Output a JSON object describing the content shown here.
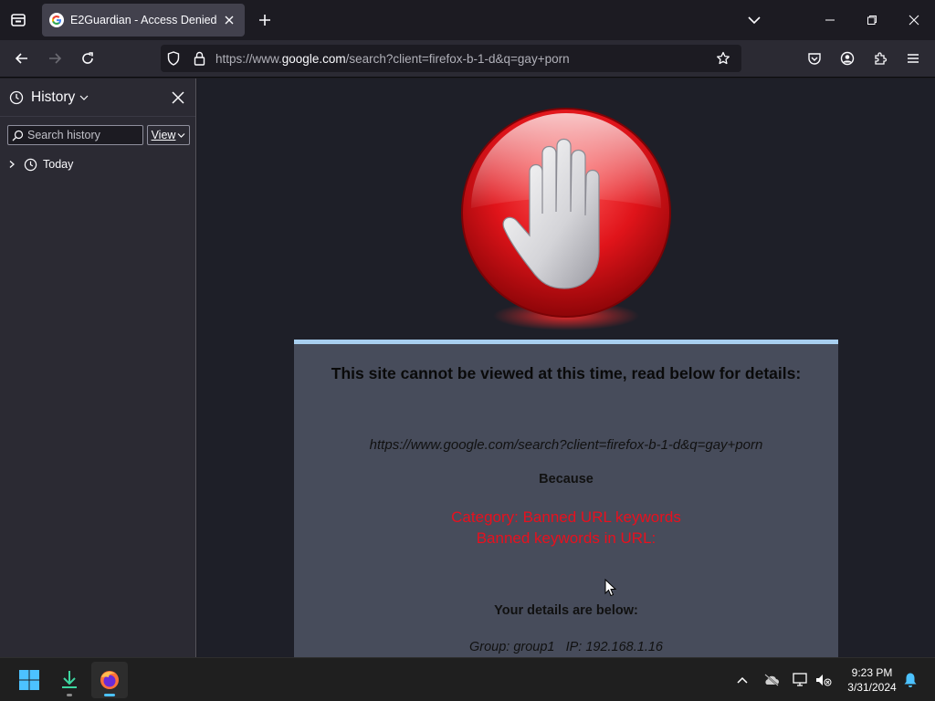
{
  "browser": {
    "tab": {
      "title": "E2Guardian - Access Denied"
    },
    "url": {
      "prefix": "https://www.",
      "domain": "google.com",
      "suffix": "/search?client=firefox-b-1-d&q=gay+porn"
    }
  },
  "sidebar": {
    "title": "History",
    "search_placeholder": "Search history",
    "view_label": "View",
    "items": [
      {
        "label": "Today"
      }
    ]
  },
  "block_page": {
    "heading": "This site cannot be viewed at this time, read below for details:",
    "blocked_url": "https://www.google.com/search?client=firefox-b-1-d&q=gay+porn",
    "because": "Because",
    "category": "Category: Banned URL keywords",
    "reason": "Banned keywords in URL:",
    "details_heading": "Your details are below:",
    "group_line": "Group: group1   IP: 192.168.1.16"
  },
  "taskbar": {
    "time": "9:23 PM",
    "date": "3/31/2024"
  },
  "colors": {
    "accent": "#4cc2ff",
    "block_red": "#e8101e",
    "panel_border": "#a8cff0"
  }
}
